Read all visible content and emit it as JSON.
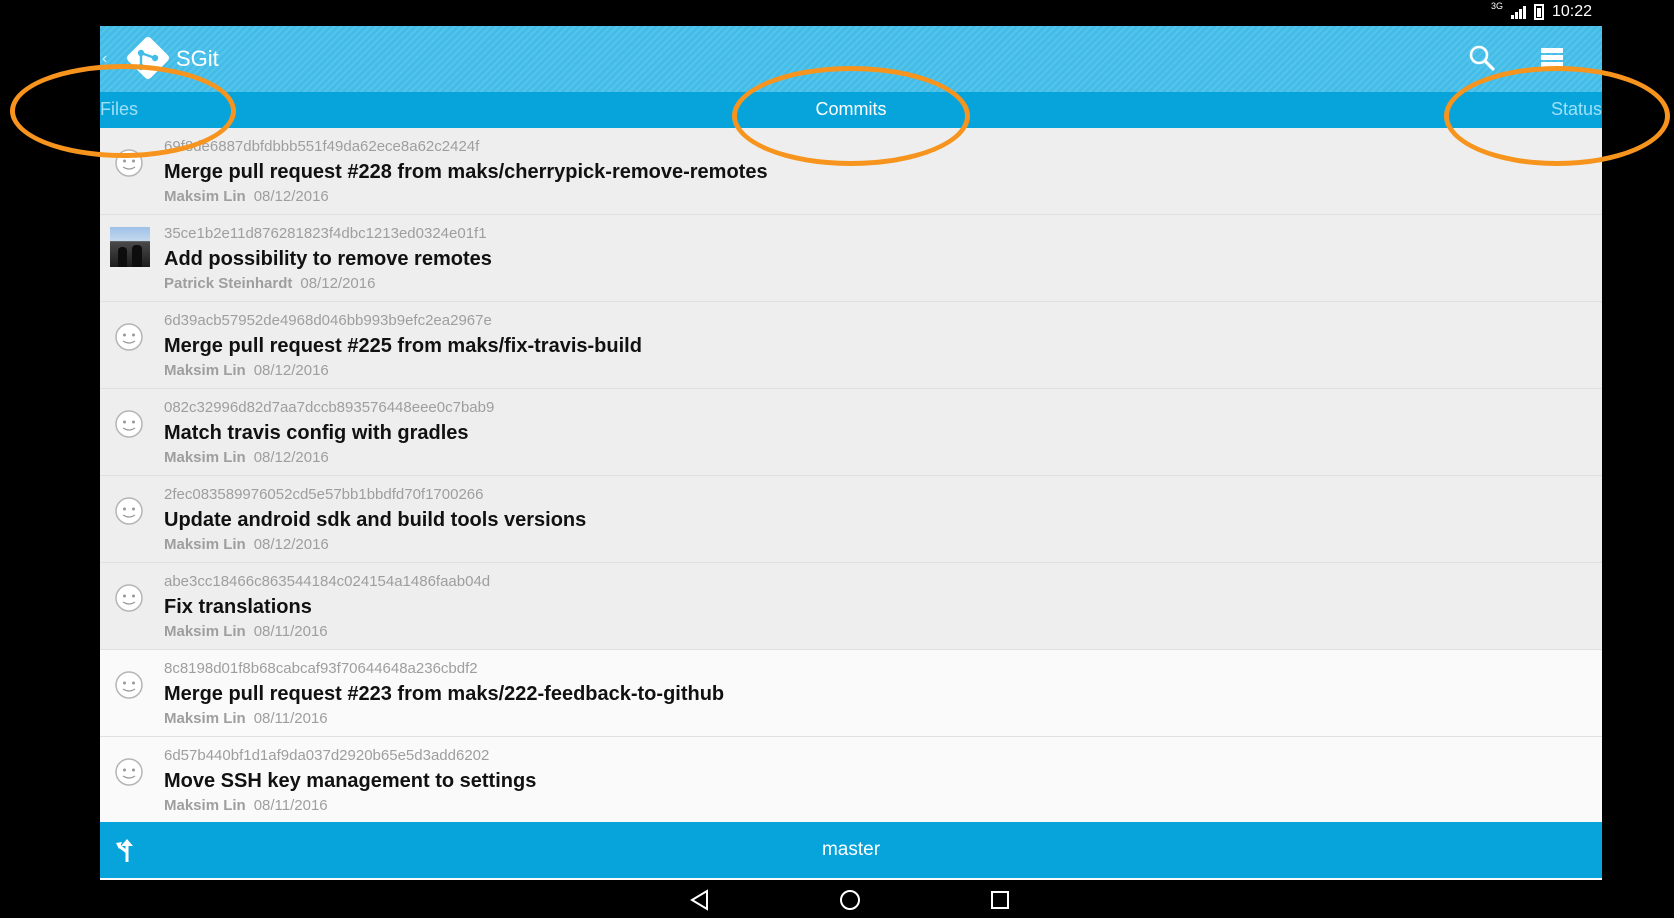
{
  "status_bar": {
    "network": "3G",
    "time": "10:22"
  },
  "app": {
    "title": "SGit"
  },
  "tabs": [
    {
      "label": "Files"
    },
    {
      "label": "Commits"
    },
    {
      "label": "Status"
    }
  ],
  "commits": [
    {
      "sha": "69f8de6887dbfdbbb551f49da62ece8a62c2424f",
      "message": "Merge pull request #228 from maks/cherrypick-remove-remotes",
      "author": "Maksim Lin",
      "date": "08/12/2016"
    },
    {
      "sha": "35ce1b2e11d876281823f4dbc1213ed0324e01f1",
      "message": "Add possibility to remove remotes",
      "author": "Patrick Steinhardt",
      "date": "08/12/2016"
    },
    {
      "sha": "6d39acb57952de4968d046bb993b9efc2ea2967e",
      "message": "Merge pull request #225 from maks/fix-travis-build",
      "author": "Maksim Lin",
      "date": "08/12/2016"
    },
    {
      "sha": "082c32996d82d7aa7dccb893576448eee0c7bab9",
      "message": "Match travis config with gradles",
      "author": "Maksim Lin",
      "date": "08/12/2016"
    },
    {
      "sha": "2fec083589976052cd5e57bb1bbdfd70f1700266",
      "message": "Update android sdk and build tools versions",
      "author": "Maksim Lin",
      "date": "08/12/2016"
    },
    {
      "sha": "abe3cc18466c863544184c024154a1486faab04d",
      "message": "Fix translations",
      "author": "Maksim Lin",
      "date": "08/11/2016"
    },
    {
      "sha": "8c8198d01f8b68cabcaf93f70644648a236cbdf2",
      "message": "Merge pull request #223 from maks/222-feedback-to-github",
      "author": "Maksim Lin",
      "date": "08/11/2016"
    },
    {
      "sha": "6d57b440bf1d1af9da037d2920b65e5d3add6202",
      "message": "Move SSH key management to settings",
      "author": "Maksim Lin",
      "date": "08/11/2016"
    }
  ],
  "branch": {
    "name": "master"
  },
  "colors": {
    "action_bar": "#43bde8",
    "tab_strip": "#07a4dc",
    "annotation": "#f7941d"
  },
  "icons": [
    "git-logo-icon",
    "search-icon",
    "menu-icon",
    "branch-icon",
    "default-avatar-icon",
    "back-icon",
    "home-icon",
    "recents-icon"
  ]
}
